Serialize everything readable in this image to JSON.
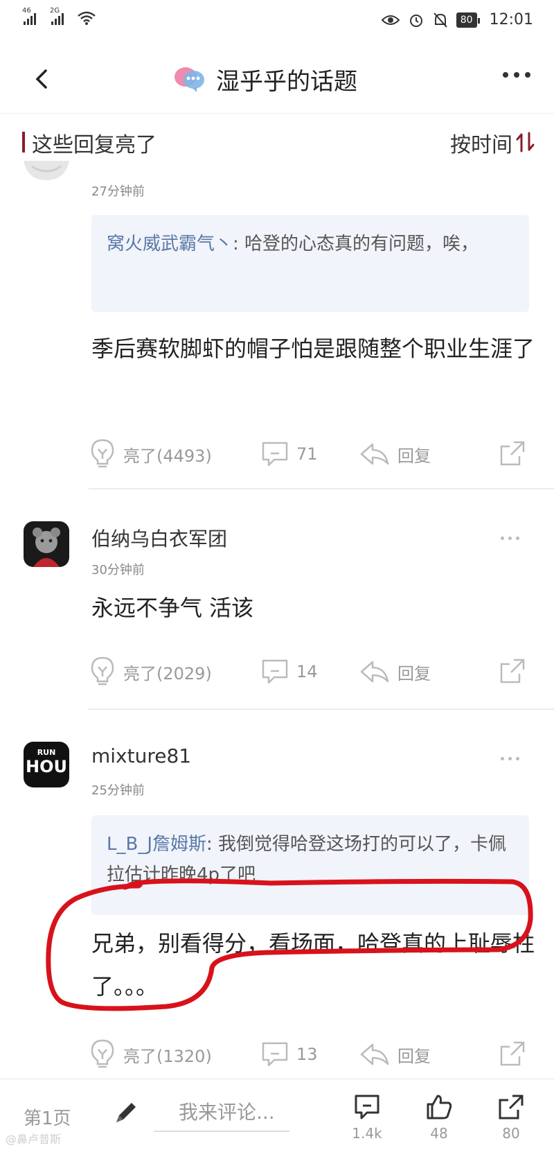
{
  "status_bar": {
    "signal1_label": "46",
    "signal2_label": "2G",
    "battery": "80",
    "time": "12:01"
  },
  "nav": {
    "title": "湿乎乎的话题"
  },
  "section": {
    "title": "这些回复亮了",
    "sort_label": "按时间"
  },
  "comments": [
    {
      "time": "27分钟前",
      "quote_name": "窝火威武霸气丶",
      "quote_text": ": 哈登的心态真的有问题，唉，",
      "body": "季后赛软脚虾的帽子怕是跟随整个职业生涯了",
      "light": "亮了(4493)",
      "replies": "71",
      "reply_label": "回复"
    },
    {
      "user": "伯纳乌白衣军团",
      "time": "30分钟前",
      "body": "永远不争气 活该",
      "light": "亮了(2029)",
      "replies": "14",
      "reply_label": "回复"
    },
    {
      "user": "mixture81",
      "avatar_text_top": "RUN",
      "avatar_text_main": "HOU",
      "time": "25分钟前",
      "quote_name": "L_B_J詹姆斯",
      "quote_text": ": 我倒觉得哈登这场打的可以了，卡佩拉估计昨晚4p了吧",
      "body": "兄弟，别看得分，看场面，哈登真的上耻辱柱了。。。",
      "light": "亮了(1320)",
      "replies": "13",
      "reply_label": "回复"
    }
  ],
  "bottom_bar": {
    "page": "第1页",
    "input_placeholder": "我来评论...",
    "comments_count": "1.4k",
    "likes_count": "48",
    "share_count": "80"
  },
  "watermark": "@鼻卢普斯",
  "colors": {
    "accent": "#8b1c2a",
    "quote_bg": "#f1f4fa",
    "quote_name": "#5a78a8",
    "annotation_red": "#d8121b"
  }
}
